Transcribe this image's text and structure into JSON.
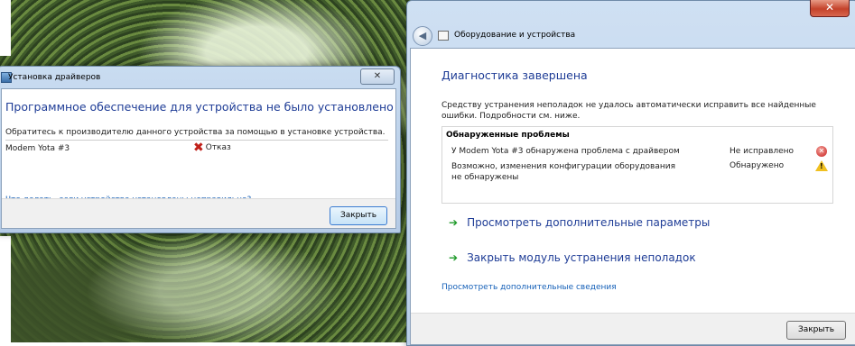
{
  "driver_window": {
    "title": "Установка драйверов",
    "close_glyph": "✕",
    "heading": "Программное обеспечение для устройства не было установлено",
    "instruction": "Обратитесь к производителю данного устройства за помощью в установке устройства.",
    "device": {
      "name": "Modem Yota #3",
      "status": "Отказ",
      "status_icon": "red-x-icon"
    },
    "help_link": "Что делать, если устройства установлены неправильно?",
    "close_button": "Закрыть"
  },
  "troubleshoot_window": {
    "close_glyph": "✕",
    "breadcrumb": "Оборудование и устройства",
    "heading": "Диагностика завершена",
    "description": "Средству устранения неполадок не удалось автоматически исправить все найденные ошибки. Подробности см. ниже.",
    "problems": {
      "title": "Обнаруженные проблемы",
      "items": [
        {
          "text": "У Modem Yota #3 обнаружена проблема с драйвером",
          "status": "Не исправлено",
          "icon": "error-icon"
        },
        {
          "text": "Возможно, изменения конфигурации оборудования не обнаружены",
          "status": "Обнаружено",
          "icon": "warning-icon"
        }
      ]
    },
    "actions": [
      {
        "label": "Просмотреть дополнительные параметры"
      },
      {
        "label": "Закрыть модуль устранения неполадок"
      }
    ],
    "more_info_link": "Просмотреть дополнительные сведения",
    "close_button": "Закрыть"
  }
}
